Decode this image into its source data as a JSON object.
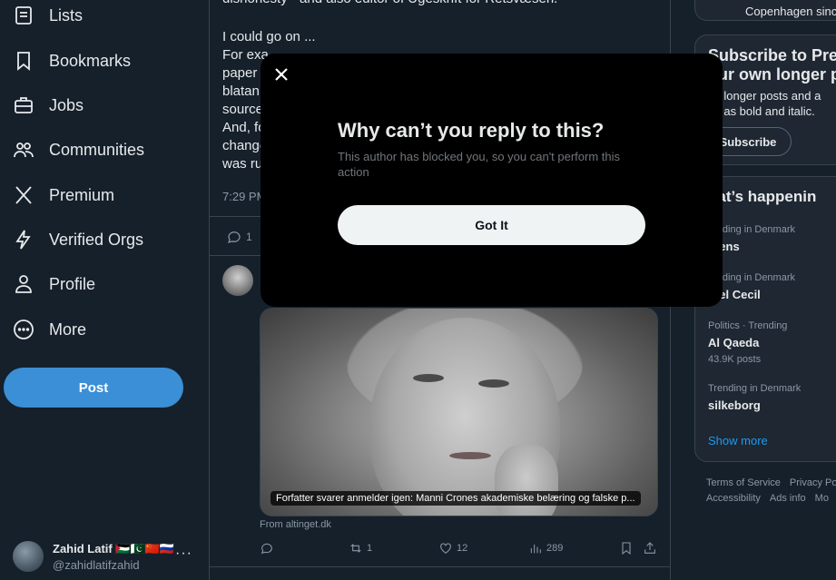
{
  "nav": {
    "items": [
      {
        "label": "Lists",
        "icon": "list-icon"
      },
      {
        "label": "Bookmarks",
        "icon": "bookmark-icon"
      },
      {
        "label": "Jobs",
        "icon": "briefcase-icon"
      },
      {
        "label": "Communities",
        "icon": "communities-icon"
      },
      {
        "label": "Premium",
        "icon": "x-logo-icon"
      },
      {
        "label": "Verified Orgs",
        "icon": "lightning-icon"
      },
      {
        "label": "Profile",
        "icon": "person-icon"
      },
      {
        "label": "More",
        "icon": "more-circle-icon"
      }
    ],
    "post_label": "Post"
  },
  "account": {
    "name": "Zahid Latif 🇵🇸🇵🇰🇨🇳🇷🇺",
    "handle": "@zahidlatifzahid",
    "more": "···"
  },
  "tweet": {
    "lines": [
      "dishonesty - and also editor of Ugeskrift for Retsvæsen.",
      "",
      "I could go on ...",
      "For exa",
      "paper",
      "blatan",
      "source",
      "And, fo",
      "change",
      "was ru"
    ],
    "time": "7:29 PM",
    "reply_count": "1"
  },
  "card": {
    "caption": "Forfatter svarer anmelder igen: Manni Crones akademiske belæring og falske p...",
    "source": "From altinget.dk",
    "actions": {
      "reply": "",
      "repost": "1",
      "like": "12",
      "views": "289"
    }
  },
  "right": {
    "location": "Copenhagen sinc",
    "subscribe": {
      "title_line1": "Subscribe to Prem",
      "title_line2": "our own longer p",
      "desc_line1": "ite longer posts and a",
      "desc_line2": "ch as bold and italic.",
      "button": "Subscribe"
    },
    "whats_happening": "hat’s happenin",
    "trends": [
      {
        "meta": "rending in Denmark",
        "name": "rsens",
        "posts": ""
      },
      {
        "meta": "rending in Denmark",
        "name": "otel Cecil",
        "posts": ""
      },
      {
        "meta": "Politics · Trending",
        "name": "Al Qaeda",
        "posts": "43.9K posts"
      },
      {
        "meta": "Trending in Denmark",
        "name": "silkeborg",
        "posts": ""
      }
    ],
    "show_more": "Show more",
    "footer": {
      "line1": [
        "Terms of Service",
        "Privacy Po"
      ],
      "line2": [
        "Accessibility",
        "Ads info",
        "Mo"
      ]
    }
  },
  "modal": {
    "title": "Why can’t you reply to this?",
    "body": "This author has blocked you, so you can't perform this action",
    "button": "Got It"
  }
}
